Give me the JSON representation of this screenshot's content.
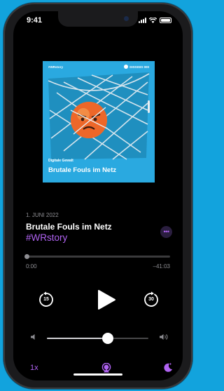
{
  "status_bar": {
    "time": "9:41"
  },
  "artwork": {
    "brand": "#WRstory",
    "logo_text": "DISSISIS 000",
    "kicker": "Digitale Gewalt",
    "title": "Brutale Fouls im Netz",
    "background_color": "#2aa9e0"
  },
  "episode": {
    "date": "1. JUNI 2022",
    "title": "Brutale Fouls im Netz",
    "show_tag": "#WRstory",
    "more_icon": "ellipsis-icon"
  },
  "progress": {
    "elapsed": "0:00",
    "remaining": "–41:03",
    "fraction": 0.0
  },
  "controls": {
    "skip_back_seconds": "15",
    "skip_forward_seconds": "30",
    "play_icon": "play-icon"
  },
  "volume": {
    "level": 0.6
  },
  "bottom_bar": {
    "speed_label": "1x",
    "airplay_icon": "airplay-icon",
    "sleep_icon": "moon-sleep-timer-icon"
  },
  "colors": {
    "accent": "#b063f2",
    "background": "#000000",
    "page_background": "#12a3dd"
  }
}
